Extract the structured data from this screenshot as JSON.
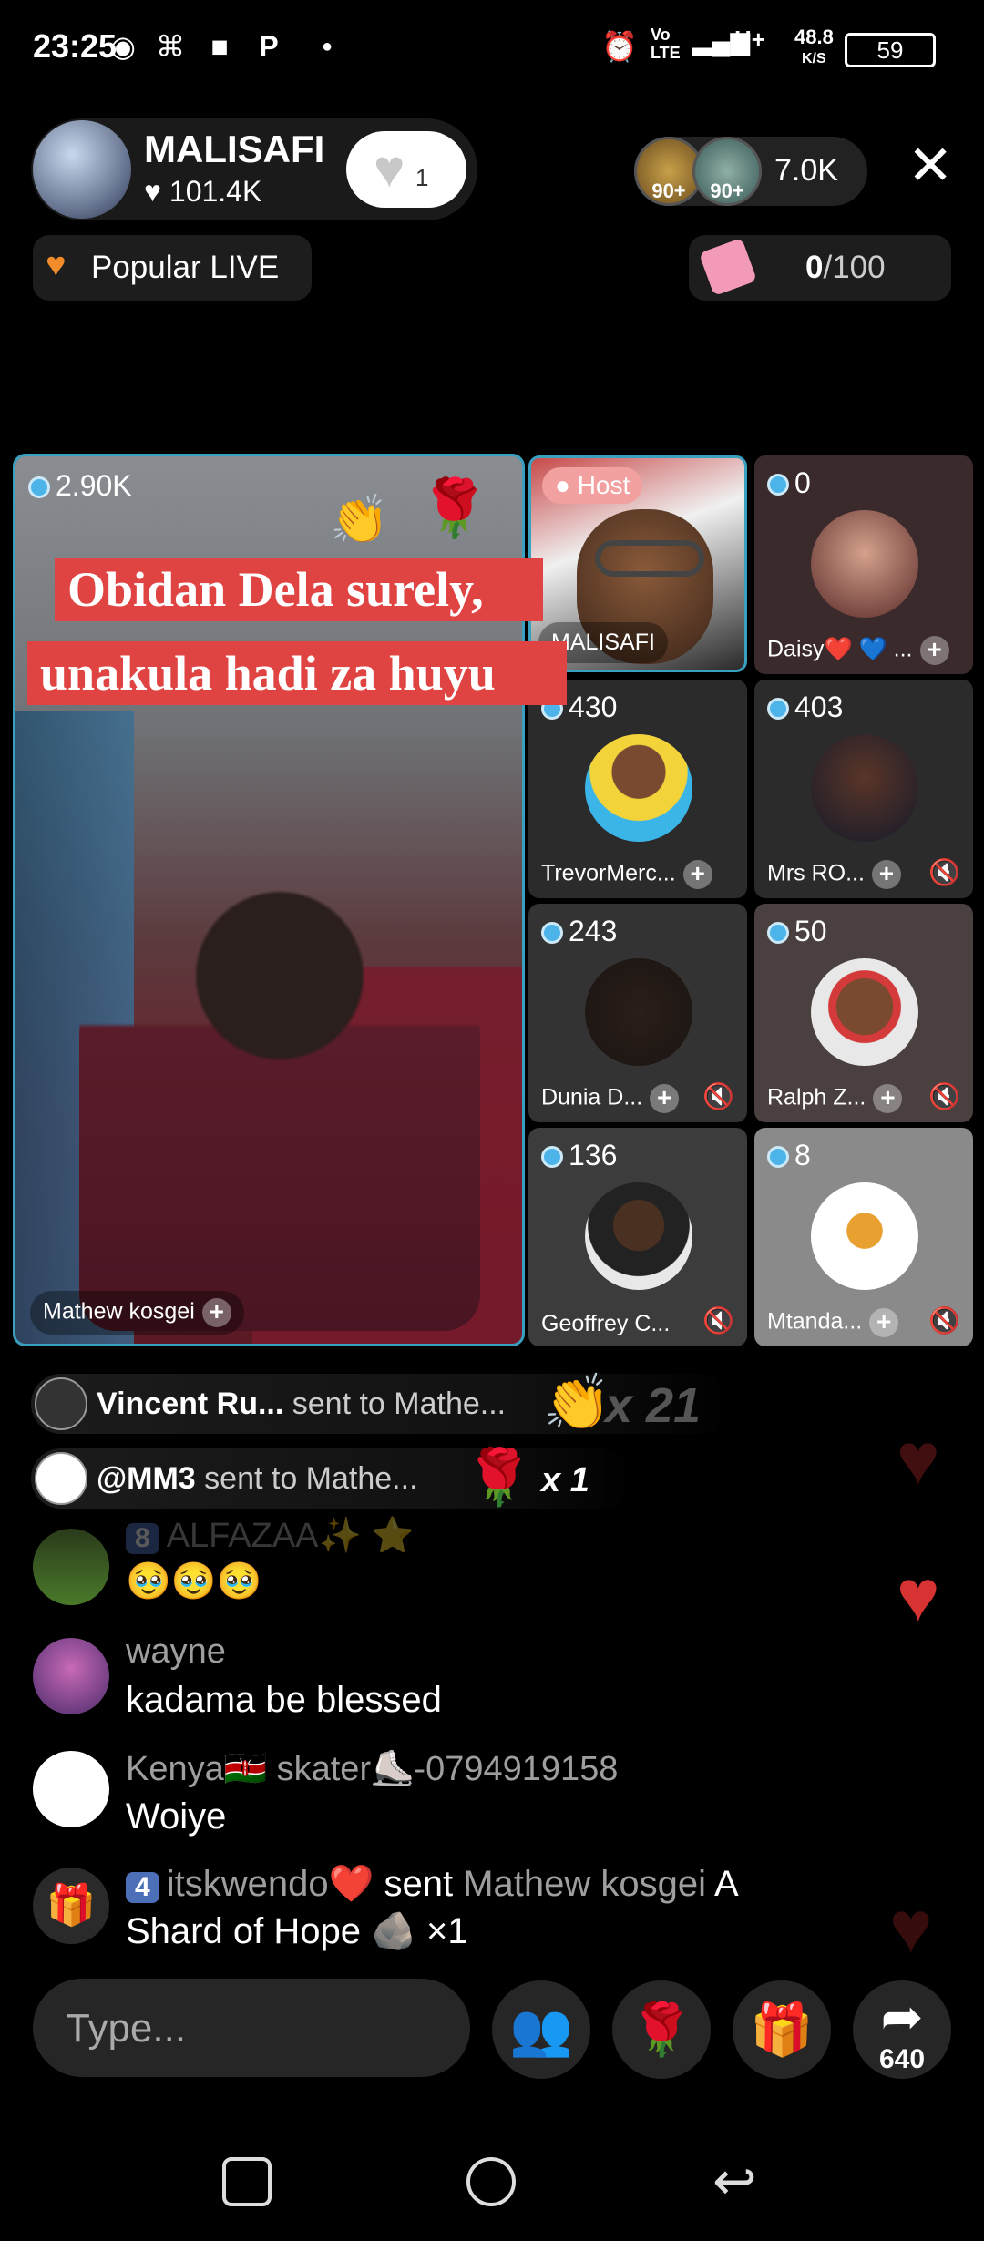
{
  "status_bar": {
    "time": "23:25",
    "net_speed": "48.8",
    "net_unit": "K/S",
    "volte": "Vo LTE",
    "network": "H+",
    "battery": "59"
  },
  "header": {
    "host_name": "MALISAFI",
    "host_likes": "101.4K",
    "follow_count": "1",
    "viewer_badge_1": "90+",
    "viewer_badge_2": "90+",
    "viewer_count": "7.0K",
    "popular_label": "Popular LIVE",
    "goal_current": "0",
    "goal_total": "/100"
  },
  "main_video": {
    "coins": "2.90K",
    "caption_line1": "Obidan Dela surely,",
    "caption_line2": "unakula hadi za huyu",
    "name": "Mathew kosgei"
  },
  "tiles": [
    {
      "label": "Host",
      "name": "MALISAFI"
    },
    {
      "coins": "0",
      "name": "Daisy❤️ 💙 ..."
    },
    {
      "coins": "430",
      "name": "TrevorMerc..."
    },
    {
      "coins": "403",
      "name": "Mrs RO..."
    },
    {
      "coins": "243",
      "name": "Dunia D..."
    },
    {
      "coins": "50",
      "name": "Ralph Z..."
    },
    {
      "coins": "136",
      "name": "Geoffrey C..."
    },
    {
      "coins": "8",
      "name": "Mtanda..."
    }
  ],
  "gift_banners": [
    {
      "name": "Vincent Ru...",
      "sent": "sent to Mathe...",
      "mult": "x 21"
    },
    {
      "name": "@MM3",
      "sent": "sent to Mathe...",
      "mult": "x 1"
    }
  ],
  "chat": [
    {
      "level": "8",
      "name": "ALFAZAA✨ ⭐",
      "msg": "🥹🥹🥹"
    },
    {
      "name": "wayne",
      "msg": "kadama be blessed"
    },
    {
      "name": "Kenya🇰🇪 skater⛸️-0794919158",
      "msg": "Woiye"
    },
    {
      "level": "4",
      "name": "itskwendo❤️",
      "sent": "sent",
      "recipient": "Mathew kosgei",
      "gift": "A",
      "line2": "Shard of Hope 🪨 ×1"
    }
  ],
  "bottom_bar": {
    "input_placeholder": "Type...",
    "share_count": "640"
  },
  "colors": {
    "accent": "#3aa0c0",
    "caption_bg": "#e04442",
    "heart": "#d83333"
  }
}
